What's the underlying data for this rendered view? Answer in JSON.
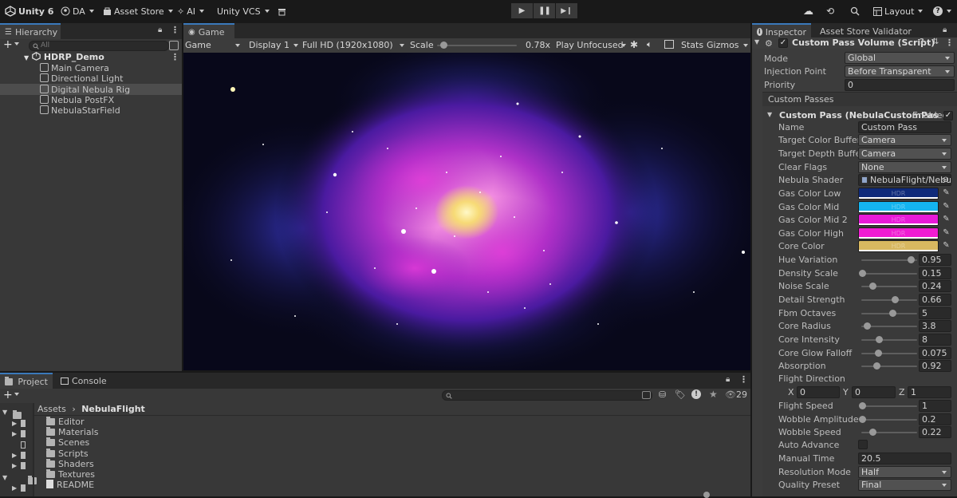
{
  "toolbar": {
    "app_title": "Unity 6",
    "account": "DA",
    "asset_store": "Asset Store",
    "ai": "AI",
    "vcs": "Unity VCS",
    "layout": "Layout"
  },
  "hierarchy": {
    "tab": "Hierarchy",
    "search_placeholder": "All",
    "scene": "HDRP_Demo",
    "items": [
      "Main Camera",
      "Directional Light",
      "Digital Nebula Rig",
      "Nebula PostFX",
      "NebulaStarField"
    ]
  },
  "game": {
    "tab": "Game",
    "display_mode": "Game",
    "display": "Display 1",
    "resolution": "Full HD (1920x1080)",
    "scale_label": "Scale",
    "scale_value": "0.78x",
    "scale_fraction": 0.08,
    "play_focus": "Play Unfocused",
    "stats": "Stats",
    "gizmos": "Gizmos"
  },
  "project": {
    "tabs": [
      "Project",
      "Console"
    ],
    "hidden_count": "29",
    "breadcrumb_root": "Assets",
    "breadcrumb_leaf": "NebulaFlight",
    "items": [
      "Editor",
      "Materials",
      "Scenes",
      "Scripts",
      "Shaders",
      "Textures",
      "README"
    ]
  },
  "inspector": {
    "tabs": [
      "Inspector",
      "Asset Store Validator"
    ],
    "component": "Custom Pass Volume (Script)",
    "mode_label": "Mode",
    "mode_value": "Global",
    "injection_label": "Injection Point",
    "injection_value": "Before Transparent",
    "priority_label": "Priority",
    "priority_value": "0",
    "custom_passes_header": "Custom Passes",
    "pass_title": "Custom Pass (NebulaCustomPas",
    "enabled_label": "Enabled",
    "name_label": "Name",
    "name_value": "Custom Pass",
    "target_color_label": "Target Color Buffer",
    "target_color_value": "Camera",
    "target_depth_label": "Target Depth Buffer",
    "target_depth_value": "Camera",
    "clear_flags_label": "Clear Flags",
    "clear_flags_value": "None",
    "shader_label": "Nebula Shader",
    "shader_value": "NebulaFlight/Nebu",
    "hdr": "HDR",
    "colors": [
      {
        "label": "Gas Color Low",
        "color": "#0f2a7a"
      },
      {
        "label": "Gas Color Mid",
        "color": "#14b4f0"
      },
      {
        "label": "Gas Color Mid 2",
        "color": "#e81ad8"
      },
      {
        "label": "Gas Color High",
        "color": "#f01cd2"
      },
      {
        "label": "Core Color",
        "color": "#d8b860"
      }
    ],
    "sliders": [
      {
        "label": "Hue Variation",
        "value": "0.95",
        "fraction": 0.88
      },
      {
        "label": "Density Scale",
        "value": "0.15",
        "fraction": 0.02
      },
      {
        "label": "Noise Scale",
        "value": "0.24",
        "fraction": 0.2
      },
      {
        "label": "Detail Strength",
        "value": "0.66",
        "fraction": 0.6
      },
      {
        "label": "Fbm Octaves",
        "value": "5",
        "fraction": 0.55
      },
      {
        "label": "Core Radius",
        "value": "3.8",
        "fraction": 0.1
      },
      {
        "label": "Core Intensity",
        "value": "8",
        "fraction": 0.32
      },
      {
        "label": "Core Glow Falloff",
        "value": "0.075",
        "fraction": 0.3
      },
      {
        "label": "Absorption",
        "value": "0.92",
        "fraction": 0.27
      }
    ],
    "flight_direction_label": "Flight Direction",
    "fd_x_label": "X",
    "fd_x": "0",
    "fd_y_label": "Y",
    "fd_y": "0",
    "fd_z_label": "Z",
    "fd_z": "1",
    "sliders2": [
      {
        "label": "Flight Speed",
        "value": "1",
        "fraction": 0.02
      },
      {
        "label": "Wobble Amplitude",
        "value": "0.2",
        "fraction": 0.02
      },
      {
        "label": "Wobble Speed",
        "value": "0.22",
        "fraction": 0.2
      }
    ],
    "auto_advance_label": "Auto Advance",
    "manual_time_label": "Manual Time",
    "manual_time_value": "20.5",
    "resolution_mode_label": "Resolution Mode",
    "resolution_mode_value": "Half",
    "quality_label": "Quality Preset",
    "quality_value": "Final"
  }
}
